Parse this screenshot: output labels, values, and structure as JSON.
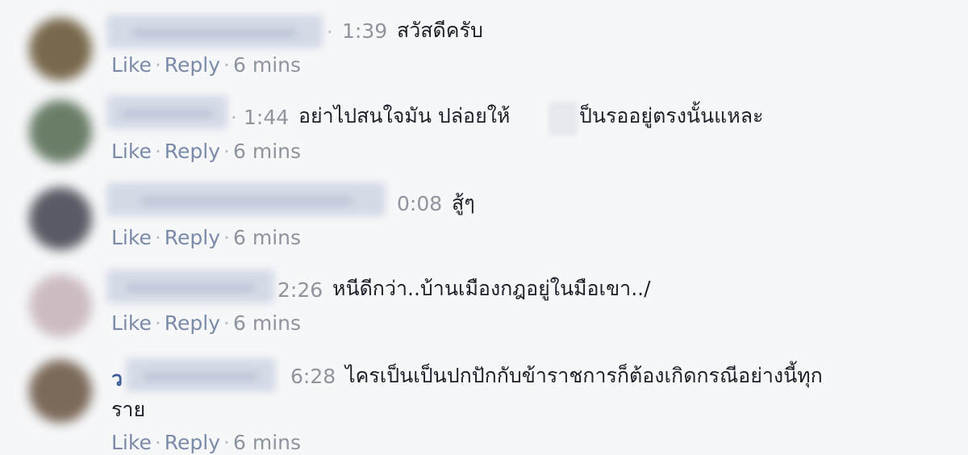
{
  "comments": [
    {
      "time": "1:39",
      "text": "สวัสดีครับ",
      "avatar_color": "#6b5a3a",
      "actions": {
        "like": "Like",
        "reply": "Reply",
        "age": "6 mins"
      }
    },
    {
      "time": "1:44",
      "text_before": "อย่าไปสนใจมัน ปล่อยให้",
      "text_after": "ป็นรออยู่ตรงนั้นแหละ",
      "avatar_color": "#5a7058",
      "actions": {
        "like": "Like",
        "reply": "Reply",
        "age": "6 mins"
      }
    },
    {
      "time": "0:08",
      "text": "สู้ๆ",
      "avatar_color": "#4a4a55",
      "actions": {
        "like": "Like",
        "reply": "Reply",
        "age": "6 mins"
      }
    },
    {
      "time": "2:26",
      "text": "หนีดีกว่า..บ้านเมืองกฎอยู่ในมือเขา../",
      "avatar_color": "#c8b6bc",
      "actions": {
        "like": "Like",
        "reply": "Reply",
        "age": "6 mins"
      }
    },
    {
      "name_prefix": "ว",
      "time": "6:28",
      "text_line1": "ไครเป็นเป็นปกปักกับข้าราชการก็ต้องเกิดกรณีอย่างนี้ทุก",
      "text_line2": "ราย",
      "avatar_color": "#6e5a48",
      "actions": {
        "like": "Like",
        "reply": "Reply",
        "age": "6 mins"
      }
    }
  ],
  "separator": "·"
}
